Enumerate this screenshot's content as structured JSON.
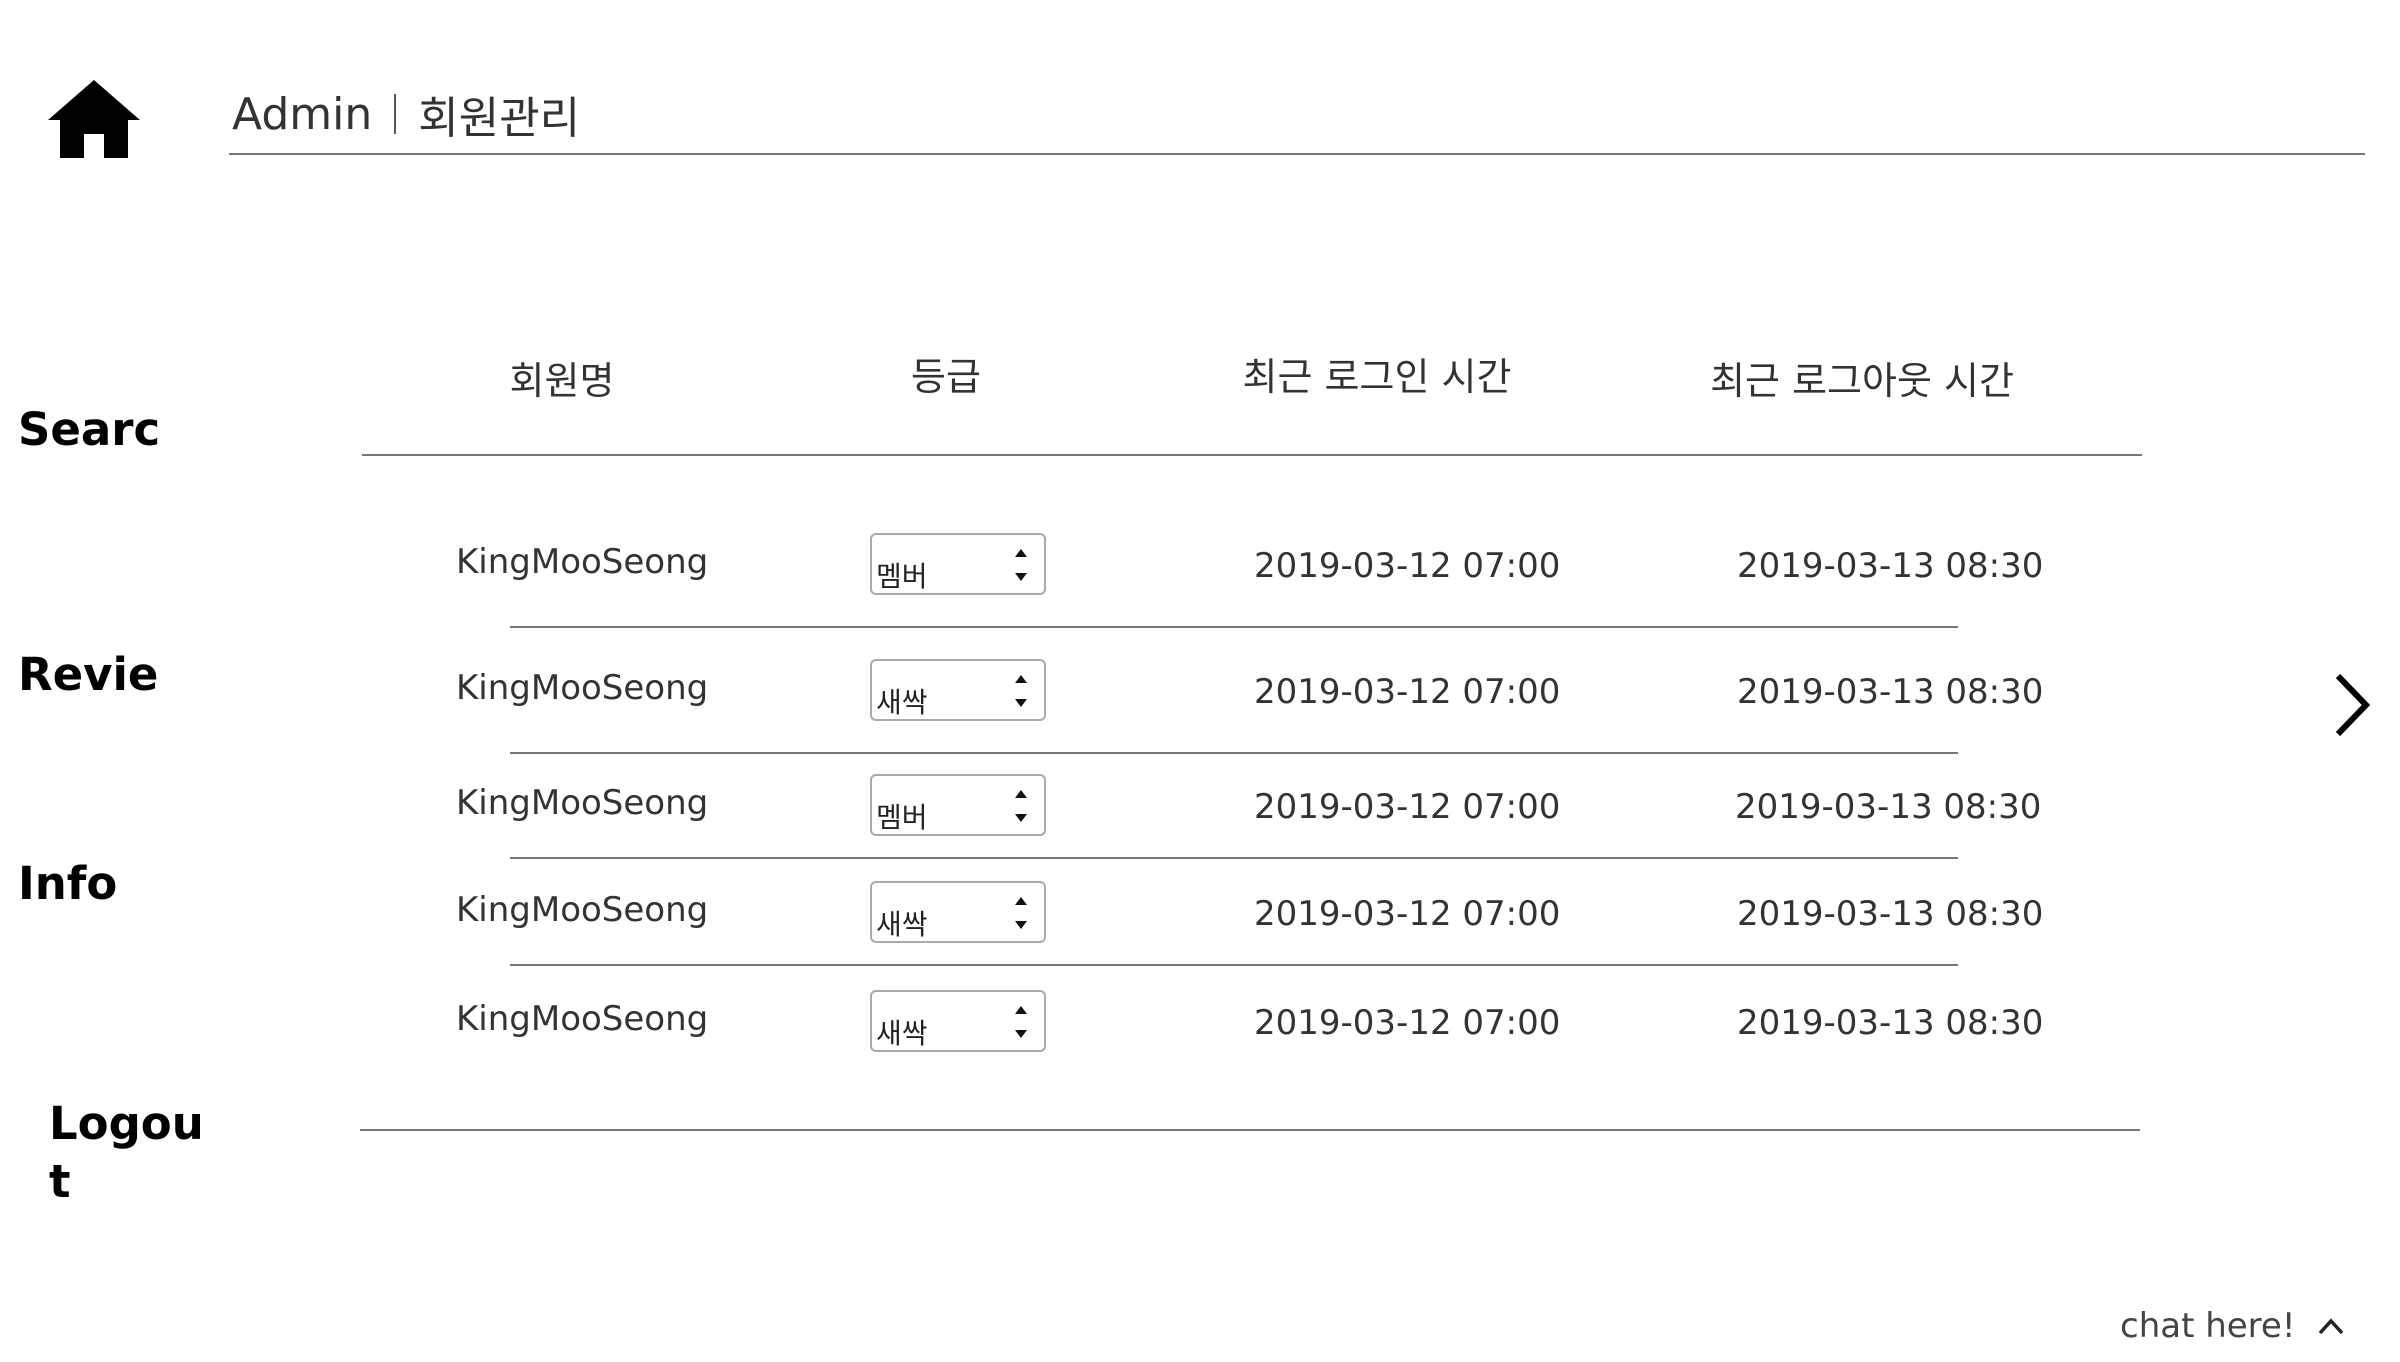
{
  "header": {
    "breadcrumb_root": "Admin",
    "breadcrumb_current": "회원관리"
  },
  "sidebar": {
    "items": [
      {
        "label": "Searc"
      },
      {
        "label": "Revie"
      },
      {
        "label": "Info"
      },
      {
        "label": "Logou\nt"
      }
    ]
  },
  "table": {
    "columns": [
      "회원명",
      "등급",
      "최근 로그인 시간",
      "최근 로그아웃 시간"
    ],
    "rows": [
      {
        "name": "KingMooSeong",
        "grade": "멤버",
        "last_login": "2019-03-12 07:00",
        "last_logout": "2019-03-13 08:30"
      },
      {
        "name": "KingMooSeong",
        "grade": "새싹",
        "last_login": "2019-03-12 07:00",
        "last_logout": "2019-03-13 08:30"
      },
      {
        "name": "KingMooSeong",
        "grade": "멤버",
        "last_login": "2019-03-12 07:00",
        "last_logout": "2019-03-13 08:30"
      },
      {
        "name": "KingMooSeong",
        "grade": "새싹",
        "last_login": "2019-03-12 07:00",
        "last_logout": "2019-03-13 08:30"
      },
      {
        "name": "KingMooSeong",
        "grade": "새싹",
        "last_login": "2019-03-12 07:00",
        "last_logout": "2019-03-13 08:30"
      }
    ]
  },
  "chat": {
    "label": "chat here!"
  },
  "icons": {
    "home": "home-icon",
    "next": "chevron-right-icon",
    "chat_toggle": "chevron-up-icon"
  }
}
